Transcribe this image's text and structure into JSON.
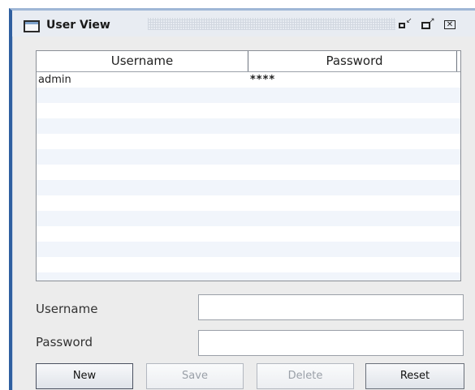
{
  "window": {
    "title": "User View",
    "controls": {
      "iconify_icon": "iconify-icon",
      "maximize_icon": "maximize-icon",
      "close_icon": "close-icon"
    }
  },
  "table": {
    "columns": [
      "Username",
      "Password"
    ],
    "rows": [
      {
        "username": "admin",
        "password": "****"
      }
    ],
    "empty_rows": 15
  },
  "form": {
    "username_label": "Username",
    "password_label": "Password",
    "username_value": "",
    "password_value": ""
  },
  "buttons": {
    "new_label": "New",
    "save_label": "Save",
    "delete_label": "Delete",
    "reset_label": "Reset",
    "save_enabled": false,
    "delete_enabled": false
  },
  "colors": {
    "frame_accent": "#2f5fa0",
    "panel_background": "#ececec",
    "row_stripe": "#f1f5fb",
    "disabled_text": "#9aa0a8"
  }
}
